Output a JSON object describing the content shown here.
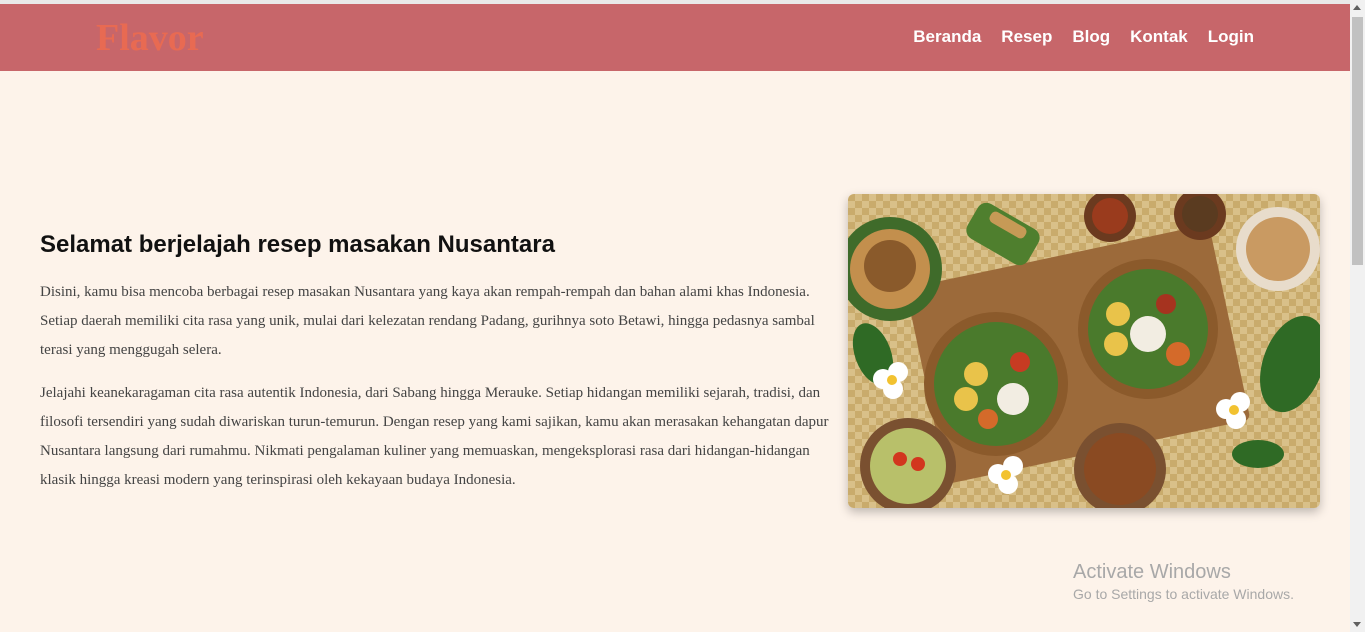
{
  "navbar": {
    "logo": "Flavor",
    "links": [
      "Beranda",
      "Resep",
      "Blog",
      "Kontak",
      "Login"
    ]
  },
  "hero": {
    "title": "Selamat berjelajah resep masakan Nusantara",
    "paragraphs": [
      "Disini, kamu bisa mencoba berbagai resep masakan Nusantara yang kaya akan rempah-rempah dan bahan alami khas Indonesia. Setiap daerah memiliki cita rasa yang unik, mulai dari kelezatan rendang Padang, gurihnya soto Betawi, hingga pedasnya sambal terasi yang menggugah selera.",
      "Jelajahi keanekaragaman cita rasa autentik Indonesia, dari Sabang hingga Merauke. Setiap hidangan memiliki sejarah, tradisi, dan filosofi tersendiri yang sudah diwariskan turun-temurun. Dengan resep yang kami sajikan, kamu akan merasakan kehangatan dapur Nusantara langsung dari rumahmu. Nikmati pengalaman kuliner yang memuaskan, mengeksplorasi rasa dari hidangan-hidangan klasik hingga kreasi modern yang terinspirasi oleh kekayaan budaya Indonesia."
    ]
  },
  "watermark": {
    "title": "Activate Windows",
    "subtitle": "Go to Settings to activate Windows."
  },
  "colors": {
    "navbar_bg": "#c7666a",
    "logo": "#e86a52",
    "page_bg": "#fdf3ea"
  }
}
